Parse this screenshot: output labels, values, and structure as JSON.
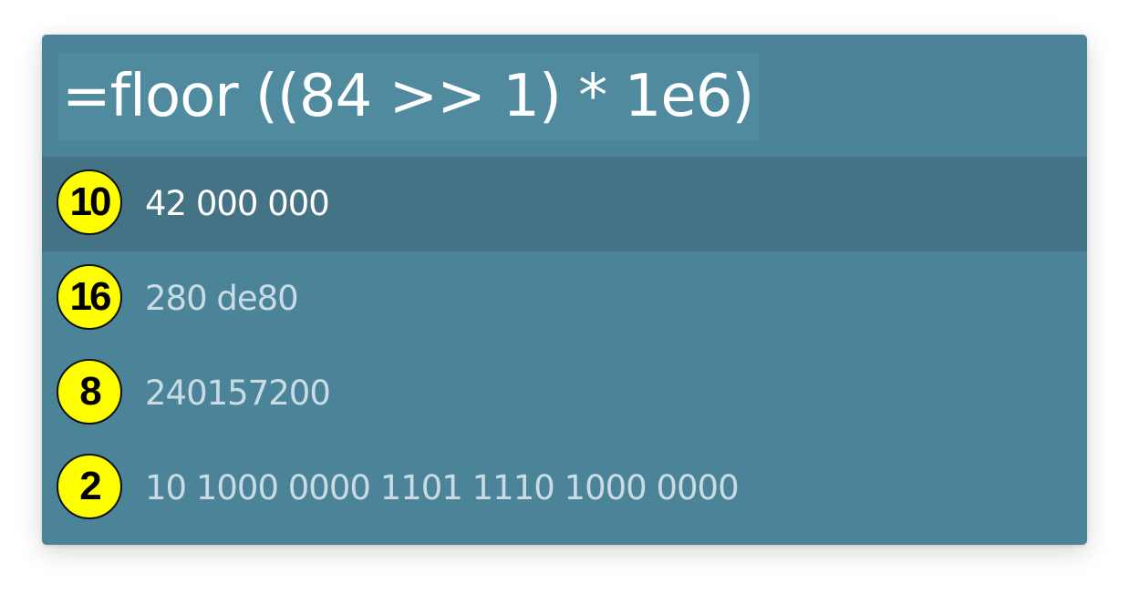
{
  "query": {
    "expression": "=floor ((84 >> 1) * 1e6)"
  },
  "results": [
    {
      "base": "10",
      "value": "42 000 000",
      "selected": true
    },
    {
      "base": "16",
      "value": "280 de80",
      "selected": false
    },
    {
      "base": "8",
      "value": "240157200",
      "selected": false
    },
    {
      "base": "2",
      "value": "10 1000 0000 1101 1110 1000 0000",
      "selected": false
    }
  ],
  "colors": {
    "panel_background": "#4b8499",
    "selected_row": "#437384",
    "badge_fill": "#ffff00",
    "value_text": "#c9dce3",
    "selected_text": "#ffffff"
  }
}
